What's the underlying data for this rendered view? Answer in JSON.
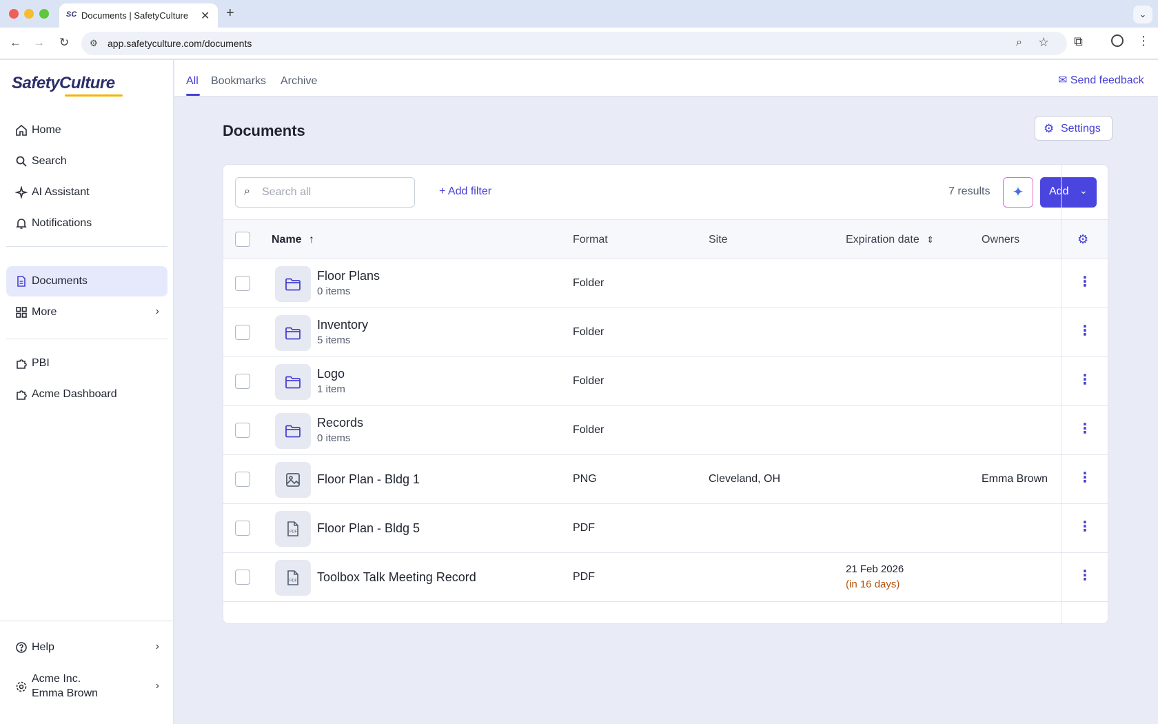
{
  "browser": {
    "tab_title": "Documents | SafetyCulture",
    "tab_favicon": "SC",
    "url": "app.safetyculture.com/documents"
  },
  "sidebar": {
    "logo": "SafetyCulture",
    "items": [
      {
        "label": "Home",
        "icon": "home-icon"
      },
      {
        "label": "Search",
        "icon": "search-icon"
      },
      {
        "label": "AI Assistant",
        "icon": "sparkle-icon"
      },
      {
        "label": "Notifications",
        "icon": "bell-icon"
      },
      {
        "label": "Documents",
        "icon": "document-icon",
        "active": true
      },
      {
        "label": "More",
        "icon": "grid-icon"
      }
    ],
    "custom_items": [
      {
        "label": "PBI",
        "icon": "puzzle-icon"
      },
      {
        "label": "Acme Dashboard",
        "icon": "puzzle-icon"
      }
    ],
    "help_label": "Help",
    "org": {
      "company": "Acme Inc.",
      "user": "Emma Brown"
    }
  },
  "topbar": {
    "tabs": [
      "All",
      "Bookmarks",
      "Archive"
    ],
    "active_tab": "All",
    "feedback_label": "Send feedback"
  },
  "page": {
    "title": "Documents",
    "settings_label": "Settings",
    "search_placeholder": "Search all",
    "add_filter_label": "Add filter",
    "results_label": "7 results",
    "add_label": "Add"
  },
  "table": {
    "columns": [
      "Name",
      "Format",
      "Site",
      "Expiration date",
      "Owners"
    ],
    "rows": [
      {
        "name": "Floor Plans",
        "sub": "0 items",
        "kind": "folder",
        "format": "Folder",
        "site": "",
        "expiration": "",
        "expiration_note": "",
        "owners": ""
      },
      {
        "name": "Inventory",
        "sub": "5 items",
        "kind": "folder",
        "format": "Folder",
        "site": "",
        "expiration": "",
        "expiration_note": "",
        "owners": ""
      },
      {
        "name": "Logo",
        "sub": "1 item",
        "kind": "folder",
        "format": "Folder",
        "site": "",
        "expiration": "",
        "expiration_note": "",
        "owners": ""
      },
      {
        "name": "Records",
        "sub": "0 items",
        "kind": "folder",
        "format": "Folder",
        "site": "",
        "expiration": "",
        "expiration_note": "",
        "owners": ""
      },
      {
        "name": "Floor Plan - Bldg 1",
        "sub": "",
        "kind": "image",
        "format": "PNG",
        "site": "Cleveland, OH",
        "expiration": "",
        "expiration_note": "",
        "owners": "Emma Brown"
      },
      {
        "name": "Floor Plan - Bldg 5",
        "sub": "",
        "kind": "pdf",
        "format": "PDF",
        "site": "",
        "expiration": "",
        "expiration_note": "",
        "owners": ""
      },
      {
        "name": "Toolbox Talk Meeting Record",
        "sub": "",
        "kind": "pdf",
        "format": "PDF",
        "site": "",
        "expiration": "21 Feb 2026",
        "expiration_note": "(in 16 days)",
        "owners": ""
      }
    ]
  },
  "colors": {
    "accent": "#4640d3",
    "sidebar_active": "#e6e9fb",
    "content_bg": "#e9ecf7",
    "warning_text": "#b4530d"
  }
}
